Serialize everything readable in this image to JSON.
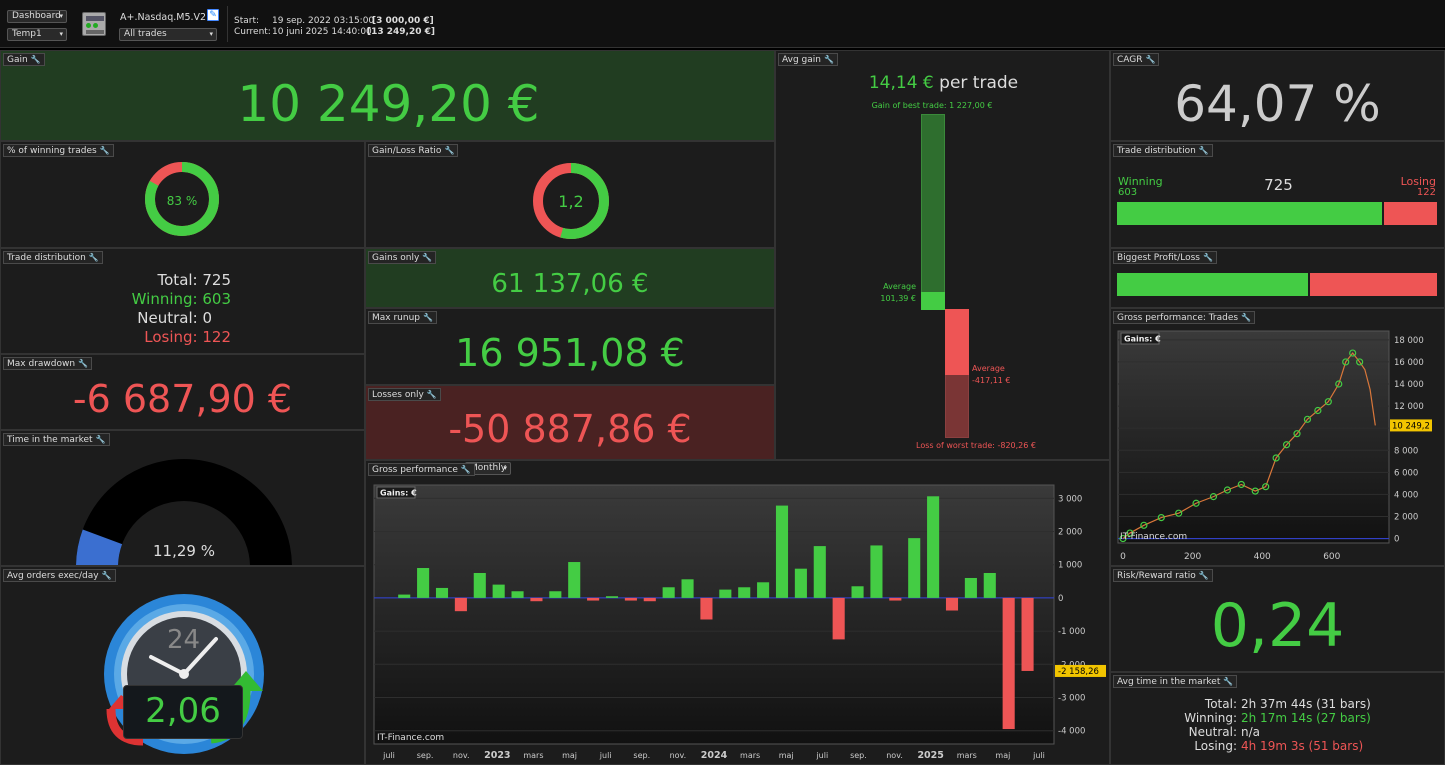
{
  "header": {
    "view_select": "Dashboard",
    "template_select": "Temp1",
    "strategy_name": "A+.Nasdaq.M5.V2.1",
    "trades_select": "All trades",
    "start_label": "Start:",
    "start_date": "19 sep. 2022 03:15:00",
    "start_value": "[3 000,00 €]",
    "current_label": "Current:",
    "current_date": "10 juni 2025 14:40:00",
    "current_value": "[13 249,20 €]"
  },
  "gain": {
    "title": "Gain",
    "value": "10 249,20 €"
  },
  "win_pct": {
    "title": "% of winning trades",
    "value": "83 %",
    "fraction": 0.83
  },
  "gl_ratio": {
    "title": "Gain/Loss Ratio",
    "value": "1,2",
    "fraction": 0.545
  },
  "trade_dist_text": {
    "title": "Trade distribution",
    "total": "Total: 725",
    "winning": "Winning: 603",
    "neutral": "Neutral: 0",
    "losing": "Losing: 122"
  },
  "gains_only": {
    "title": "Gains only",
    "value": "61 137,06 €"
  },
  "max_runup": {
    "title": "Max runup",
    "value": "16 951,08 €"
  },
  "max_drawdown": {
    "title": "Max drawdown",
    "value": "-6 687,90 €"
  },
  "losses_only": {
    "title": "Losses only",
    "value": "-50 887,86 €"
  },
  "time_in_market": {
    "title": "Time in the market",
    "value": "11,29 %",
    "fraction": 0.1129
  },
  "avg_orders": {
    "title": "Avg orders exec/day",
    "value": "2,06",
    "dial_number": "24"
  },
  "avg_gain": {
    "title": "Avg gain",
    "value": "14,14 €",
    "suffix": "per trade",
    "best_label": "Gain of best trade: 1 227,00 €",
    "avg_win_label": "Average",
    "avg_win_value": "101,39 €",
    "avg_loss_label": "Average",
    "avg_loss_value": "-417,11 €",
    "worst_label": "Loss of worst trade: -820,26 €"
  },
  "cagr": {
    "title": "CAGR",
    "value": "64,07 %"
  },
  "trade_dist_bar": {
    "title": "Trade distribution",
    "winning_label": "Winning",
    "winning_value": "603",
    "total": "725",
    "losing_label": "Losing",
    "losing_value": "122",
    "win_fraction": 0.832
  },
  "biggest_pl": {
    "title": "Biggest Profit/Loss",
    "profit": 1227.0,
    "loss": 820.26
  },
  "gross_trades": {
    "title": "Gross performance: Trades",
    "legend": "Gains: €",
    "watermark": "IT-Finance.com",
    "last_value": "10 249,2",
    "y_ticks": [
      "18 000",
      "16 000",
      "14 000",
      "12 000",
      "10 000",
      "8 000",
      "6 000",
      "4 000",
      "2 000",
      "0"
    ],
    "x_ticks": [
      "0",
      "200",
      "400",
      "600"
    ]
  },
  "gross_monthly": {
    "title": "Gross performance",
    "period_select": "Monthly",
    "legend": "Gains: €",
    "watermark": "IT-Finance.com",
    "last_value": "-2 158,26",
    "y_ticks": [
      "3 000",
      "2 000",
      "1 000",
      "0",
      "-1 000",
      "-2 000",
      "-3 000",
      "-4 000"
    ],
    "x_ticks": [
      "juli",
      "sep.",
      "nov.",
      "2023",
      "mars",
      "maj",
      "juli",
      "sep.",
      "nov.",
      "2024",
      "mars",
      "maj",
      "juli",
      "sep.",
      "nov.",
      "2025",
      "mars",
      "maj",
      "juli"
    ]
  },
  "risk_reward": {
    "title": "Risk/Reward ratio",
    "value": "0,24"
  },
  "avg_time": {
    "title": "Avg time in the market",
    "total_label": "Total:",
    "total_value": "2h 37m 44s (31 bars)",
    "winning_label": "Winning:",
    "winning_value": "2h 17m 14s (27 bars)",
    "neutral_label": "Neutral:",
    "neutral_value": "n/a",
    "losing_label": "Losing:",
    "losing_value": "4h 19m 3s (51 bars)"
  },
  "chart_data": [
    {
      "type": "bar",
      "ylabel": "Gains: €",
      "ylim": [
        -4400,
        3400
      ],
      "categories": [
        "2022-09",
        "2022-10",
        "2022-11",
        "2022-12",
        "2023-01",
        "2023-02",
        "2023-03",
        "2023-04",
        "2023-05",
        "2023-06",
        "2023-07",
        "2023-08",
        "2023-09",
        "2023-10",
        "2023-11",
        "2023-12",
        "2024-01",
        "2024-02",
        "2024-03",
        "2024-04",
        "2024-05",
        "2024-06",
        "2024-07",
        "2024-08",
        "2024-09",
        "2024-10",
        "2024-11",
        "2024-12",
        "2025-01",
        "2025-02",
        "2025-03",
        "2025-04",
        "2025-05",
        "2025-06"
      ],
      "values": [
        100,
        900,
        300,
        -400,
        750,
        400,
        200,
        -100,
        200,
        1080,
        -80,
        50,
        -80,
        -100,
        320,
        560,
        -650,
        250,
        320,
        470,
        2780,
        880,
        1560,
        -1250,
        350,
        1580,
        -80,
        1800,
        3060,
        -380,
        600,
        750,
        -3950,
        -2200
      ]
    },
    {
      "type": "line",
      "ylabel": "Gains: €",
      "ylim": [
        -400,
        18800
      ],
      "x": [
        0,
        20,
        60,
        110,
        160,
        210,
        260,
        300,
        340,
        380,
        410,
        440,
        470,
        500,
        530,
        560,
        590,
        620,
        640,
        660,
        680,
        695,
        710,
        725
      ],
      "values": [
        0,
        500,
        1200,
        1900,
        2300,
        3200,
        3800,
        4400,
        4900,
        4300,
        4700,
        7300,
        8500,
        9500,
        10800,
        11600,
        12400,
        14000,
        16000,
        16800,
        16000,
        15300,
        13500,
        10249
      ]
    }
  ]
}
